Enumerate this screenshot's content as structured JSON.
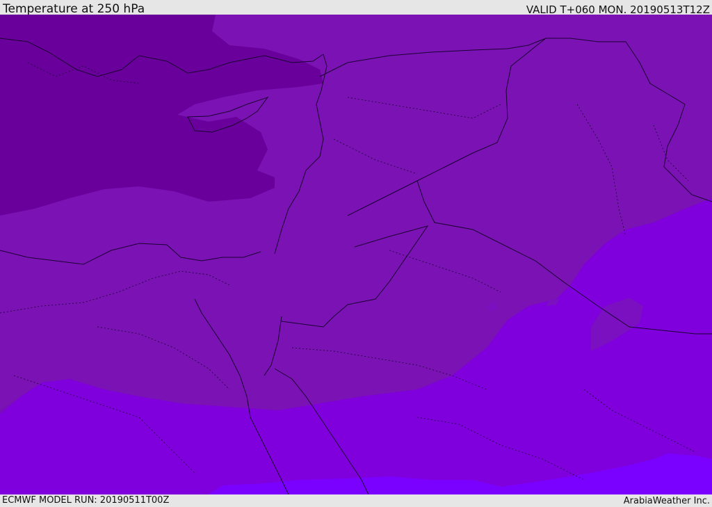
{
  "header": {
    "title": "Temperature at 250 hPa",
    "valid": "VALID T+060 MON. 20190513T12Z"
  },
  "footer": {
    "model_run": "ECMWF MODEL RUN: 20190511T00Z",
    "credit": "ArabiaWeather Inc."
  },
  "colors": {
    "coldest": "#6a009c",
    "cold": "#7a12b4",
    "mid": "#7808ba",
    "warm": "#7f00dc",
    "warmest": "#7a00ff",
    "boundary": "#1a0030"
  }
}
